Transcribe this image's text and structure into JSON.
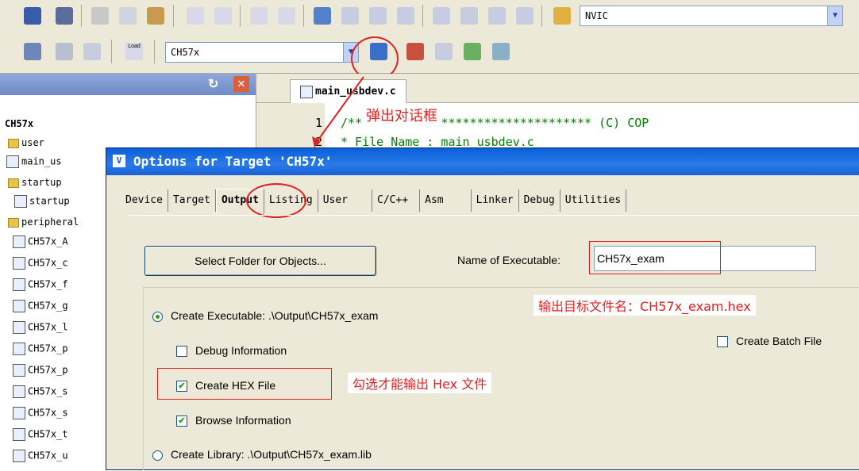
{
  "toolbar": {
    "nvic_combo": "NVIC",
    "target_combo": "CH57x",
    "load_label": "Load"
  },
  "project": {
    "root": "CH57x",
    "folders": [
      "user",
      "startup",
      "peripheral"
    ],
    "files": [
      "main_us",
      "startup",
      "CH57x_A",
      "CH57x_c",
      "CH57x_f",
      "CH57x_g",
      "CH57x_l",
      "CH57x_p",
      "CH57x_p",
      "CH57x_s",
      "CH57x_s",
      "CH57x_t",
      "CH57x_u"
    ]
  },
  "editor": {
    "tab": "main_usbdev.c",
    "line1_num": "1",
    "line2_num": "2",
    "line1_text": "/********************************** (C) COP",
    "line2_text": "* File Name          : main_usbdev.c"
  },
  "dialog": {
    "title": "Options for Target 'CH57x'",
    "tabs": [
      "Device",
      "Target",
      "Output",
      "Listing",
      "User",
      "C/C++",
      "Asm",
      "Linker",
      "Debug",
      "Utilities"
    ],
    "active_tab": "Output",
    "select_folder_button": "Select Folder for Objects...",
    "name_exe_label": "Name of Executable:",
    "name_exe_value": "CH57x_exam",
    "create_exe": "Create Executable:  .\\Output\\CH57x_exam",
    "debug_info": "Debug Information",
    "create_hex": "Create HEX File",
    "browse_info": "Browse Information",
    "create_lib": "Create Library:  .\\Output\\CH57x_exam.lib",
    "create_batch": "Create Batch File"
  },
  "annotations": {
    "popup_dialog": "弹出对话框",
    "output_name": "输出目标文件名：CH57x_exam.hex",
    "check_hex": "勾选才能输出 Hex 文件"
  },
  "colors": {
    "annotation_red": "#e02020",
    "title_blue": "#0a5fd8",
    "xp_face": "#ece9d8"
  }
}
